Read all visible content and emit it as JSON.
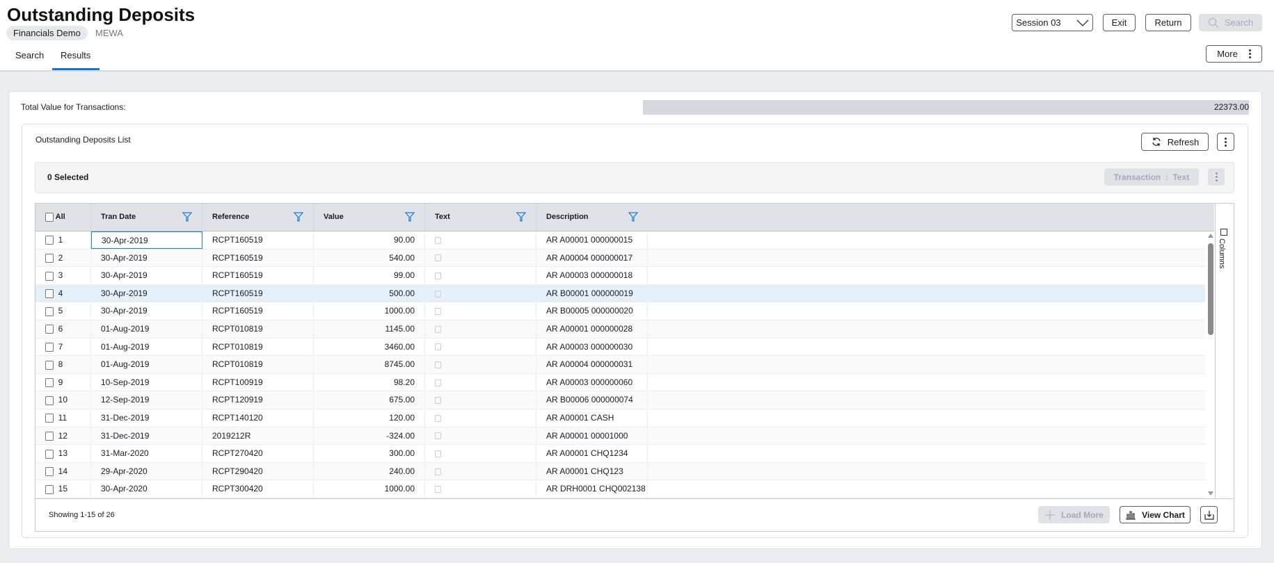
{
  "header": {
    "title": "Outstanding Deposits",
    "company": "Financials Demo",
    "user": "MEWA",
    "tabs": [
      {
        "label": "Search"
      },
      {
        "label": "Results"
      }
    ],
    "session_label": "Session 03",
    "exit_label": "Exit",
    "return_label": "Return",
    "search_label": "Search",
    "more_label": "More"
  },
  "total": {
    "label": "Total Value for Transactions:",
    "value": "22373.00"
  },
  "list": {
    "title": "Outstanding Deposits List",
    "refresh_label": "Refresh",
    "selected_label": "0 Selected",
    "transaction_label": "Transaction  :  Text"
  },
  "grid": {
    "columns": [
      "All",
      "Tran Date",
      "Reference",
      "Value",
      "Text",
      "Description"
    ],
    "side_panel": "Columns",
    "rows": [
      [
        "1",
        "30-Apr-2019",
        "RCPT160519",
        "90.00",
        "AR A00001 000000015"
      ],
      [
        "2",
        "30-Apr-2019",
        "RCPT160519",
        "540.00",
        "AR A00004 000000017"
      ],
      [
        "3",
        "30-Apr-2019",
        "RCPT160519",
        "99.00",
        "AR A00003 000000018"
      ],
      [
        "4",
        "30-Apr-2019",
        "RCPT160519",
        "500.00",
        "AR B00001 000000019"
      ],
      [
        "5",
        "30-Apr-2019",
        "RCPT160519",
        "1000.00",
        "AR B00005 000000020"
      ],
      [
        "6",
        "01-Aug-2019",
        "RCPT010819",
        "1145.00",
        "AR A00001 000000028"
      ],
      [
        "7",
        "01-Aug-2019",
        "RCPT010819",
        "3460.00",
        "AR A00003 000000030"
      ],
      [
        "8",
        "01-Aug-2019",
        "RCPT010819",
        "8745.00",
        "AR A00004 000000031"
      ],
      [
        "9",
        "10-Sep-2019",
        "RCPT100919",
        "98.20",
        "AR A00003 000000060"
      ],
      [
        "10",
        "12-Sep-2019",
        "RCPT120919",
        "675.00",
        "AR B00006 000000074"
      ],
      [
        "11",
        "31-Dec-2019",
        "RCPT140120",
        "120.00",
        "AR A00001 CASH"
      ],
      [
        "12",
        "31-Dec-2019",
        "2019212R",
        "-324.00",
        "AR A00001 00001000"
      ],
      [
        "13",
        "31-Mar-2020",
        "RCPT270420",
        "300.00",
        "AR A00001 CHQ1234"
      ],
      [
        "14",
        "29-Apr-2020",
        "RCPT290420",
        "240.00",
        "AR A00001 CHQ123"
      ],
      [
        "15",
        "30-Apr-2020",
        "RCPT300420",
        "1000.00",
        "AR DRH0001 CHQ002138"
      ]
    ],
    "highlighted_row": 4,
    "footer": {
      "showing": "Showing 1-15 of 26",
      "load_more_label": "Load More",
      "view_chart_label": "View Chart"
    }
  },
  "colors": {
    "accent": "#1776d1",
    "highlight": "#e4f0fa"
  }
}
